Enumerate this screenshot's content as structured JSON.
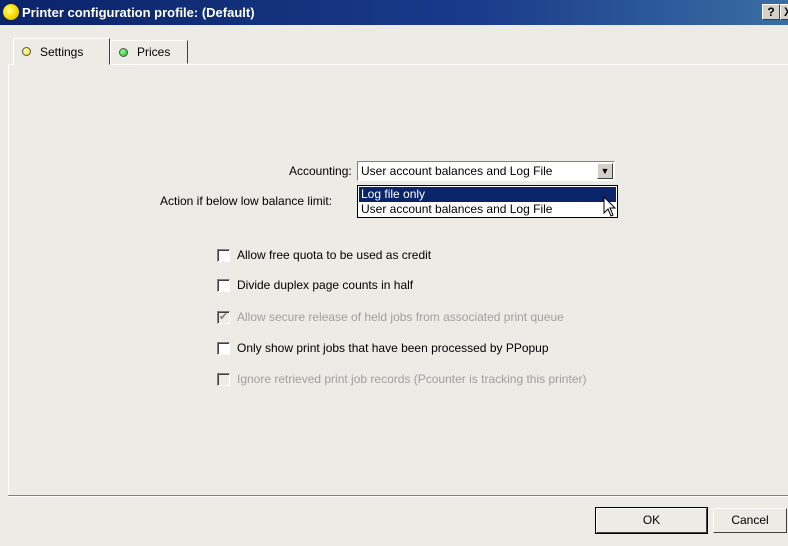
{
  "window": {
    "title": "Printer configuration profile: (Default)",
    "help_label": "?",
    "close_label": "X"
  },
  "tabs": [
    {
      "label": "Settings",
      "indicator_color": "#f0e000",
      "active": true
    },
    {
      "label": "Prices",
      "indicator_color": "#00c000",
      "active": false
    }
  ],
  "settings": {
    "accounting_label": "Accounting:",
    "accounting_value": "User account balances and Log File",
    "action_label": "Action if below low balance limit:",
    "dropdown_options": [
      "Log file only",
      "User account balances and Log File"
    ],
    "highlighted_option": "Log file only"
  },
  "checkboxes": [
    {
      "label": "Allow free quota to be used as credit",
      "checked": false,
      "enabled": true
    },
    {
      "label": "Divide duplex page counts in half",
      "checked": false,
      "enabled": true
    },
    {
      "label": "Allow secure release of held jobs from associated print queue",
      "checked": true,
      "enabled": false
    },
    {
      "label": "Only show print jobs that have been processed by PPopup",
      "checked": false,
      "enabled": true
    },
    {
      "label": "Ignore retrieved print job records (Pcounter is tracking this printer)",
      "checked": false,
      "enabled": false
    }
  ],
  "buttons": {
    "ok_label": "OK",
    "cancel_label": "Cancel"
  },
  "colors": {
    "titlebar": "#0a246a",
    "selection": "#0a246a",
    "dialog_face": "#ecebe6"
  }
}
